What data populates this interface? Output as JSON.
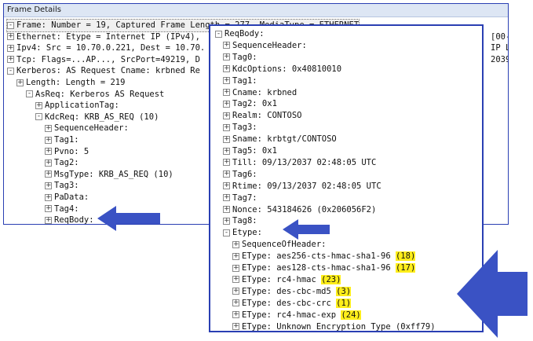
{
  "window": {
    "title": "Frame Details"
  },
  "colors": {
    "border": "#2a3fb3",
    "arrow": "#3a52c4",
    "highlight": "#ffee1a"
  },
  "left_tree": [
    {
      "text": "Frame: Number = 19, Captured Frame Length = 277, MediaType = ETHERNET",
      "expander": "-"
    },
    {
      "text": "Ethernet: Etype = Internet IP (IPv4),",
      "expander": "+",
      "tail": "[00-1"
    },
    {
      "text": "Ipv4: Src = 10.70.0.221, Dest = 10.70.",
      "expander": "+",
      "tail": "IP Le"
    },
    {
      "text": "Tcp: Flags=...AP..., SrcPort=49219, D",
      "expander": "+",
      "tail": "2039"
    },
    {
      "text": "Kerberos: AS Request Cname: krbned Re",
      "expander": "-"
    },
    {
      "text": "Length: Length = 219",
      "expander": "+"
    },
    {
      "text": "AsReq: Kerberos AS Request",
      "expander": "-"
    },
    {
      "text": "ApplicationTag:",
      "expander": "+"
    },
    {
      "text": "KdcReq: KRB_AS_REQ (10)",
      "expander": "-"
    },
    {
      "text": "SequenceHeader:",
      "expander": "+"
    },
    {
      "text": "Tag1:",
      "expander": "+"
    },
    {
      "text": "Pvno: 5",
      "expander": "+"
    },
    {
      "text": "Tag2:",
      "expander": "+"
    },
    {
      "text": "MsgType: KRB_AS_REQ (10)",
      "expander": "+"
    },
    {
      "text": "Tag3:",
      "expander": "+"
    },
    {
      "text": "PaData:",
      "expander": "+"
    },
    {
      "text": "Tag4:",
      "expander": "+"
    },
    {
      "text": "ReqBody:",
      "expander": "+"
    }
  ],
  "popup_tree": [
    {
      "text": "ReqBody:",
      "expander": "-"
    },
    {
      "text": "SequenceHeader:",
      "expander": "+"
    },
    {
      "text": "Tag0:",
      "expander": "+"
    },
    {
      "text": "KdcOptions: 0x40810010",
      "expander": "+"
    },
    {
      "text": "Tag1:",
      "expander": "+"
    },
    {
      "text": "Cname: krbned",
      "expander": "+"
    },
    {
      "text": "Tag2: 0x1",
      "expander": "+"
    },
    {
      "text": "Realm: CONTOSO",
      "expander": "+"
    },
    {
      "text": "Tag3:",
      "expander": "+"
    },
    {
      "text": "Sname: krbtgt/CONTOSO",
      "expander": "+"
    },
    {
      "text": "Tag5: 0x1",
      "expander": "+"
    },
    {
      "text": "Till: 09/13/2037 02:48:05 UTC",
      "expander": "+"
    },
    {
      "text": "Tag6:",
      "expander": "+"
    },
    {
      "text": "Rtime: 09/13/2037 02:48:05 UTC",
      "expander": "+"
    },
    {
      "text": "Tag7:",
      "expander": "+"
    },
    {
      "text": "Nonce: 543184626 (0x206056F2)",
      "expander": "+"
    },
    {
      "text": "Tag8:",
      "expander": "+"
    },
    {
      "text": "Etype:",
      "expander": "-"
    },
    {
      "text": "SequenceOfHeader:",
      "expander": "+"
    },
    {
      "text": "EType: aes256-cts-hmac-sha1-96",
      "expander": "+",
      "code": "(18)"
    },
    {
      "text": "EType: aes128-cts-hmac-sha1-96",
      "expander": "+",
      "code": "(17)"
    },
    {
      "text": "EType: rc4-hmac",
      "expander": "+",
      "code": "(23)"
    },
    {
      "text": "EType: des-cbc-md5",
      "expander": "+",
      "code": "(3)"
    },
    {
      "text": "EType: des-cbc-crc",
      "expander": "+",
      "code": "(1)"
    },
    {
      "text": "EType: rc4-hmac-exp",
      "expander": "+",
      "code": "(24)"
    },
    {
      "text": "EType: Unknown Encryption Type (0xff79)",
      "expander": "+"
    }
  ]
}
